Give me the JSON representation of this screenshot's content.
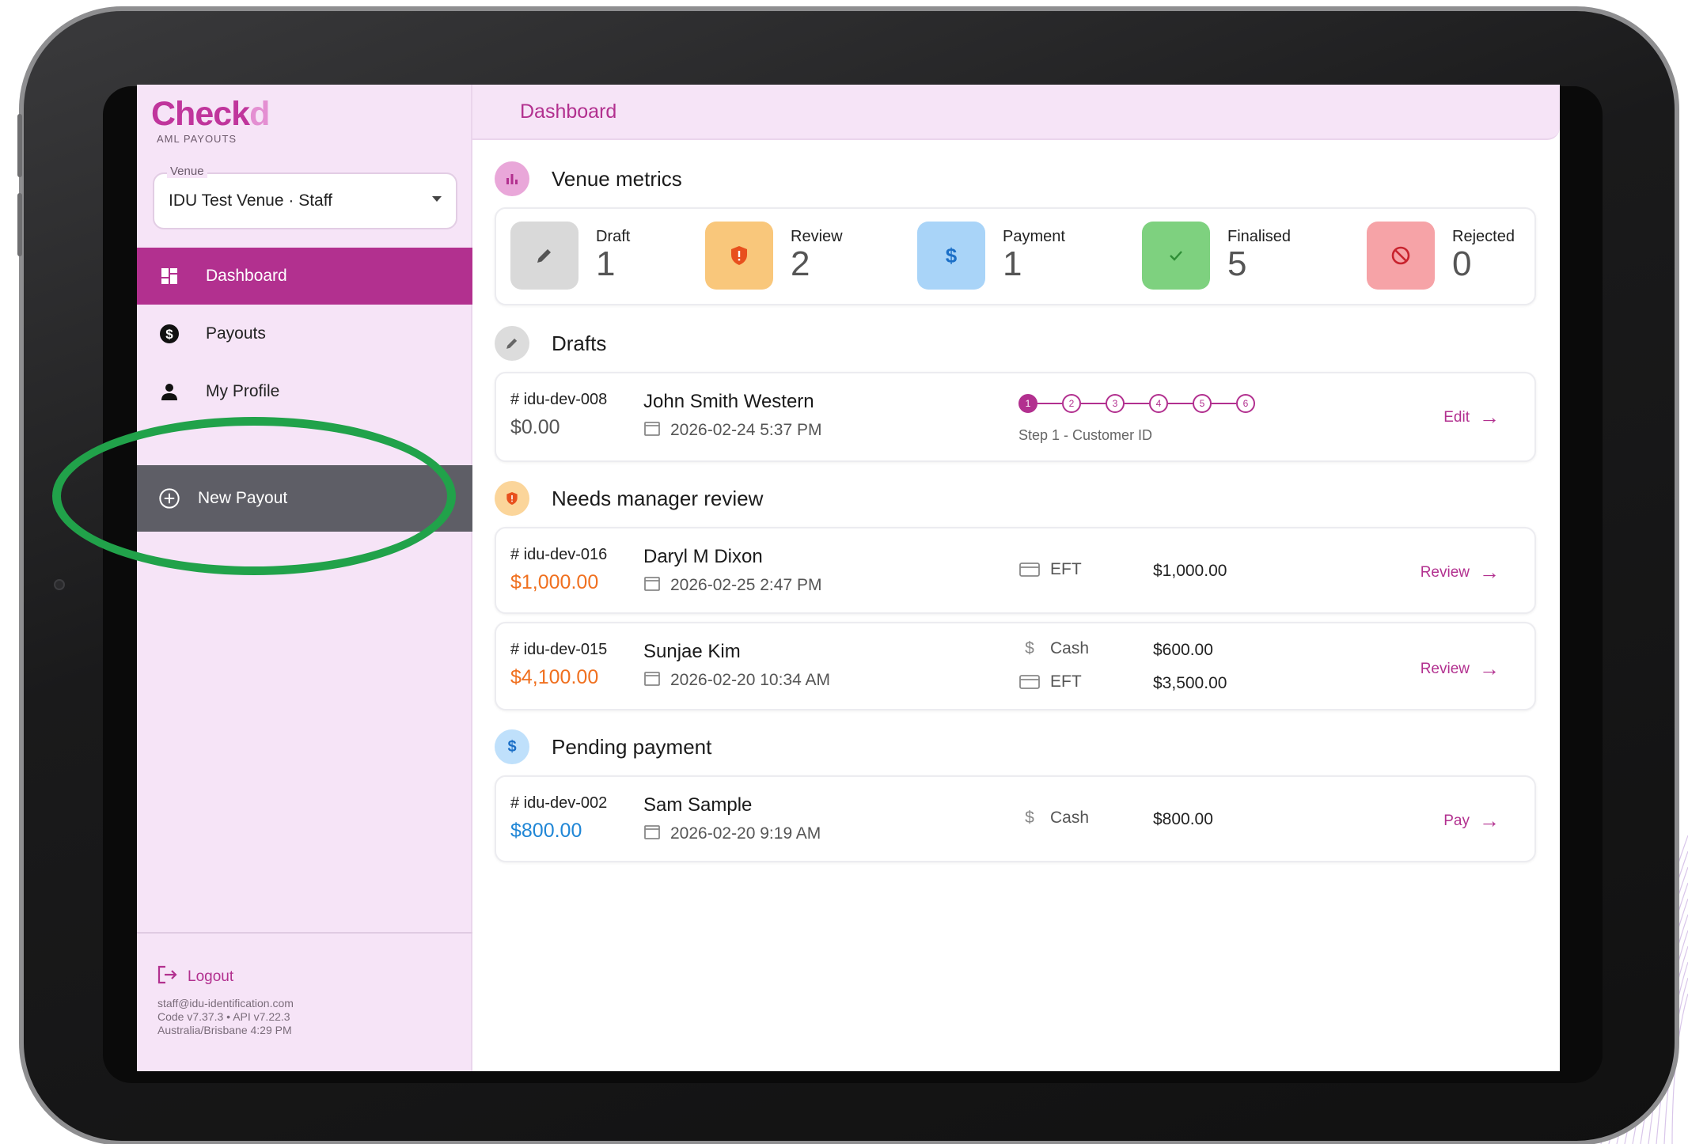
{
  "brand": {
    "name_main": "Check",
    "name_accent": "d",
    "subtitle": "AML PAYOUTS",
    "accent_color": "#b2308f"
  },
  "venue": {
    "label": "Venue",
    "value": "IDU Test Venue · Staff"
  },
  "nav": {
    "items": [
      {
        "label": "Dashboard",
        "icon": "dashboard-icon",
        "active": true
      },
      {
        "label": "Payouts",
        "icon": "dollar-circle-icon",
        "active": false
      },
      {
        "label": "My Profile",
        "icon": "person-icon",
        "active": false
      }
    ],
    "new_payout": "New Payout"
  },
  "footer": {
    "logout": "Logout",
    "email": "staff@idu-identification.com",
    "versions": "Code v7.37.3 • API v7.22.3",
    "timezone": "Australia/Brisbane 4:29 PM"
  },
  "header": {
    "title": "Dashboard"
  },
  "metrics": {
    "title": "Venue metrics",
    "items": [
      {
        "label": "Draft",
        "value": "1",
        "icon": "pencil-icon",
        "color": "#d9d9d9"
      },
      {
        "label": "Review",
        "value": "2",
        "icon": "shield-alert-icon",
        "color": "#f9c77b"
      },
      {
        "label": "Payment",
        "value": "1",
        "icon": "dollar-icon",
        "color": "#a9d4f8"
      },
      {
        "label": "Finalised",
        "value": "5",
        "icon": "check-icon",
        "color": "#7ed17f"
      },
      {
        "label": "Rejected",
        "value": "0",
        "icon": "block-icon",
        "color": "#f6a3a7"
      }
    ]
  },
  "drafts": {
    "title": "Drafts",
    "rows": [
      {
        "id": "# idu-dev-008",
        "amount": "$0.00",
        "name": "John Smith Western",
        "date": "2026-02-24 5:37 PM",
        "steps": [
          "1",
          "2",
          "3",
          "4",
          "5",
          "6"
        ],
        "current_step": "Step 1 - Customer ID",
        "action": "Edit"
      }
    ]
  },
  "review": {
    "title": "Needs manager review",
    "rows": [
      {
        "id": "# idu-dev-016",
        "amount": "$1,000.00",
        "name": "Daryl M Dixon",
        "date": "2026-02-25 2:47 PM",
        "methods": [
          {
            "method": "EFT",
            "amount": "$1,000.00"
          }
        ],
        "action": "Review"
      },
      {
        "id": "# idu-dev-015",
        "amount": "$4,100.00",
        "name": "Sunjae Kim",
        "date": "2026-02-20 10:34 AM",
        "methods": [
          {
            "method": "Cash",
            "amount": "$600.00"
          },
          {
            "method": "EFT",
            "amount": "$3,500.00"
          }
        ],
        "action": "Review"
      }
    ]
  },
  "pending": {
    "title": "Pending payment",
    "rows": [
      {
        "id": "# idu-dev-002",
        "amount": "$800.00",
        "name": "Sam Sample",
        "date": "2026-02-20 9:19 AM",
        "methods": [
          {
            "method": "Cash",
            "amount": "$800.00"
          }
        ],
        "action": "Pay"
      }
    ]
  },
  "colors": {
    "review_amount": "#f0701f",
    "pending_amount": "#1f86d6",
    "draft_amount": "#555555",
    "highlight": "#21a24a"
  }
}
